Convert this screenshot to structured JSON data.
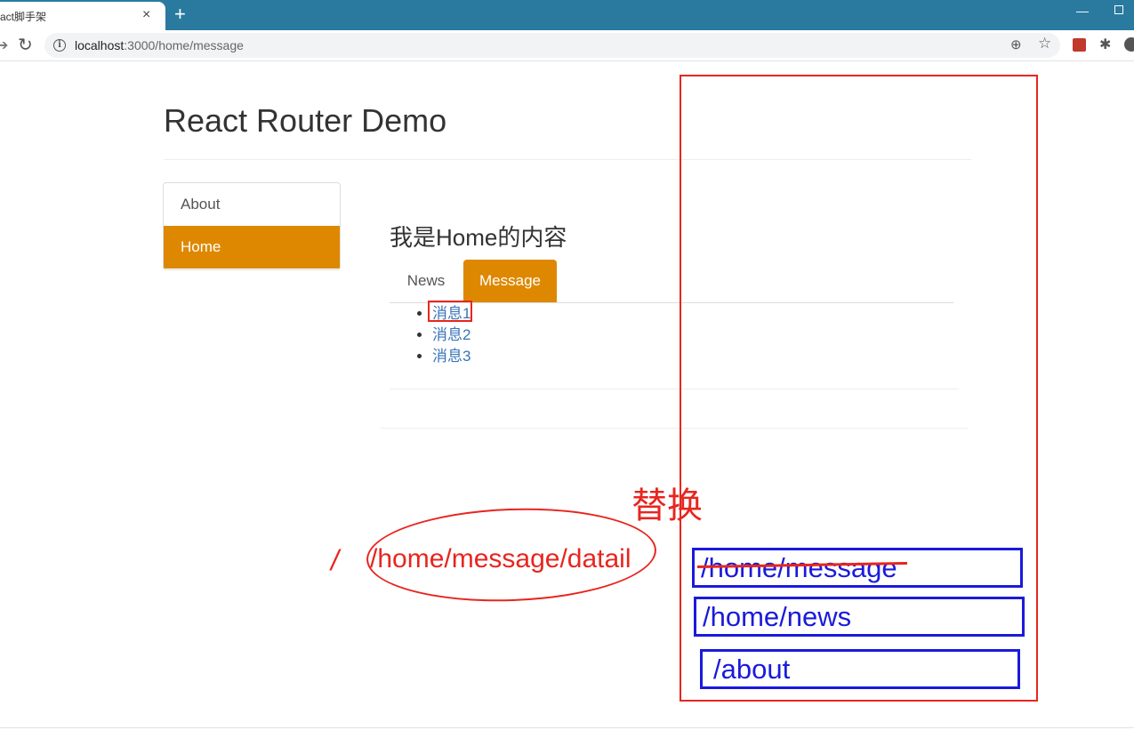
{
  "browser": {
    "tab_title": "act脚手架",
    "tab_close": "×",
    "new_tab": "+",
    "url_host": "localhost",
    "url_rest": ":3000/home/message"
  },
  "page": {
    "header": "React Router Demo",
    "nav": [
      "About",
      "Home"
    ],
    "nav_active": "Home",
    "home_title": "我是Home的内容",
    "subtabs": [
      "News",
      "Message"
    ],
    "subtab_active": "Message",
    "messages": [
      "消息1",
      "消息2",
      "消息3"
    ]
  },
  "annotations": {
    "replace_label": "替换",
    "slash": "/",
    "detail_path": "/home/message/datail",
    "history_stack": [
      "/home/message",
      "/home/news",
      "/about"
    ],
    "red_color": "#e8251f",
    "blue_color": "#1a1adc"
  },
  "colors": {
    "active_bg": "#dd8800",
    "tabbar": "#2a7aa0",
    "link": "#3a74b8"
  }
}
